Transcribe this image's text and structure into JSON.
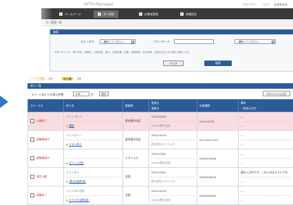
{
  "app": {
    "title": "HITO-Manager"
  },
  "top_links": [
    "ログアウト",
    "ヘルプ",
    "各種事業者"
  ],
  "nav": {
    "tabs": [
      {
        "label": "ホームページ",
        "active": false
      },
      {
        "label": "求人管理",
        "active": true
      },
      {
        "label": "応募者管理",
        "active": false
      },
      {
        "label": "各種設定",
        "active": false
      }
    ]
  },
  "breadcrumb": "求人管理一覧",
  "search": {
    "header": "検索",
    "status_label": "ステータス",
    "status_value": "--選択してください--",
    "keyword_label": "フリーワード",
    "keyword_select": "--選択してください--",
    "hint": "※求人タイトル、求人内容、勤務地、仕事内容、給与、応募資格、待遇、勤務時間、休日休暇、応募方法などを対象に検索します。",
    "clear_label": "クリア",
    "search_label": "検索"
  },
  "legend": {
    "a_label": "公開期間外",
    "a_text": "…1件",
    "b_label": "非公開",
    "b_text": "…1件"
  },
  "list": {
    "header": "求人一覧",
    "per_page_label": "1ページあたりの表示件数",
    "per_page_value": "10件",
    "per_page_unit": "件",
    "per_page_button": "表示",
    "csv_button": "CSVファイル出力"
  },
  "table": {
    "columns": [
      {
        "top": "ステータス",
        "bottom": ""
      },
      {
        "top": "求人名",
        "bottom": ""
      },
      {
        "top": "勤務地",
        "bottom": ""
      },
      {
        "top": "登録日",
        "bottom": "更新日"
      },
      {
        "top": "応募期間",
        "bottom": ""
      },
      {
        "top": "備考",
        "bottom": "一覧表示文字"
      }
    ],
    "rows": [
      {
        "status": "公開終了",
        "highlight": true,
        "name_top": "テスト 求人2",
        "name": "事務",
        "area": "東京都渋谷区",
        "date1": "2012/10/25",
        "date2": "ALEHN株式会社",
        "period": "2012/10/31",
        "note_top": "―",
        "note_bottom": "―"
      },
      {
        "status": "募集開始中",
        "highlight": false,
        "name_top": "テスト求人1",
        "name": "テスト求人",
        "area": "東京都渋谷区",
        "date1": "2012/10/15",
        "date2": "株式会社テスト入力",
        "period": "03-1234-1234",
        "note_top": "―",
        "note_bottom": "―"
      },
      {
        "status": "募集開始中",
        "highlight": false,
        "name_top": "",
        "name": "オフィス(仮)",
        "area": "テスト入力",
        "date1": "2012/10/01",
        "date2": "ALEHN株式会社",
        "period": "0300072000",
        "note_top": "―",
        "note_bottom": "―"
      },
      {
        "status": "限定公開",
        "highlight": false,
        "name_top": "テスト求人",
        "name": "(株)企画部(仮)",
        "area": "全国",
        "date1": "2012/10/01",
        "date2": "株式会社テスト入力",
        "period": "0300000000",
        "note_top": "現在入力中です。この入力はテストです。",
        "note_bottom": "―"
      },
      {
        "status": "募集終了",
        "highlight": false,
        "name_top": "テスト求人名前",
        "name": "ヒトマネ太郎(仮)",
        "area": "全国",
        "date1": "2012/10/10",
        "date2": "ALEHN株式会社",
        "period": "0300000000",
        "note_top": "―",
        "note_bottom": "―"
      }
    ]
  },
  "colors": {
    "brand": "#2c5b9a",
    "nav": "#3a3a3a",
    "highlight_row": "#f9dde0",
    "arrow": "#2a7ac7",
    "legend_a": "#e9b23f",
    "legend_b": "#f4d35e"
  }
}
